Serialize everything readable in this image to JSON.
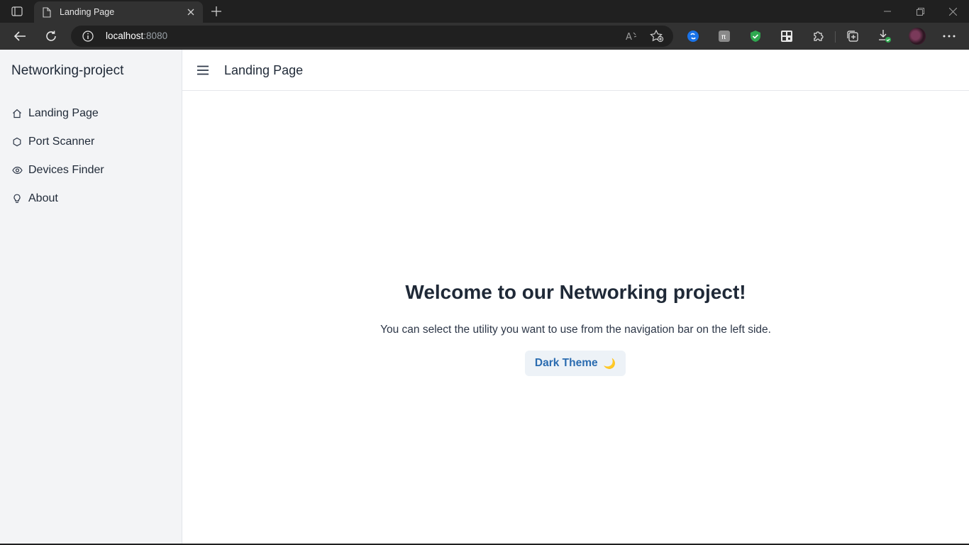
{
  "browser": {
    "tab": {
      "title": "Landing Page"
    },
    "address": {
      "host": "localhost",
      "port": ":8080"
    }
  },
  "sidebar": {
    "brand": "Networking-project",
    "items": [
      {
        "label": "Landing Page",
        "icon": "home-icon"
      },
      {
        "label": "Port Scanner",
        "icon": "circle-icon"
      },
      {
        "label": "Devices Finder",
        "icon": "eye-icon"
      },
      {
        "label": "About",
        "icon": "lightbulb-icon"
      }
    ]
  },
  "header": {
    "title": "Landing Page"
  },
  "main": {
    "heading": "Welcome to our Networking project!",
    "subtitle": "You can select the utility you want to use from the navigation bar on the left side.",
    "theme_button": {
      "label": "Dark Theme",
      "icon": "🌙"
    }
  },
  "colors": {
    "accent": "#2b6cb0",
    "sidebar_bg": "#f3f4f6",
    "text": "#1f2937"
  }
}
